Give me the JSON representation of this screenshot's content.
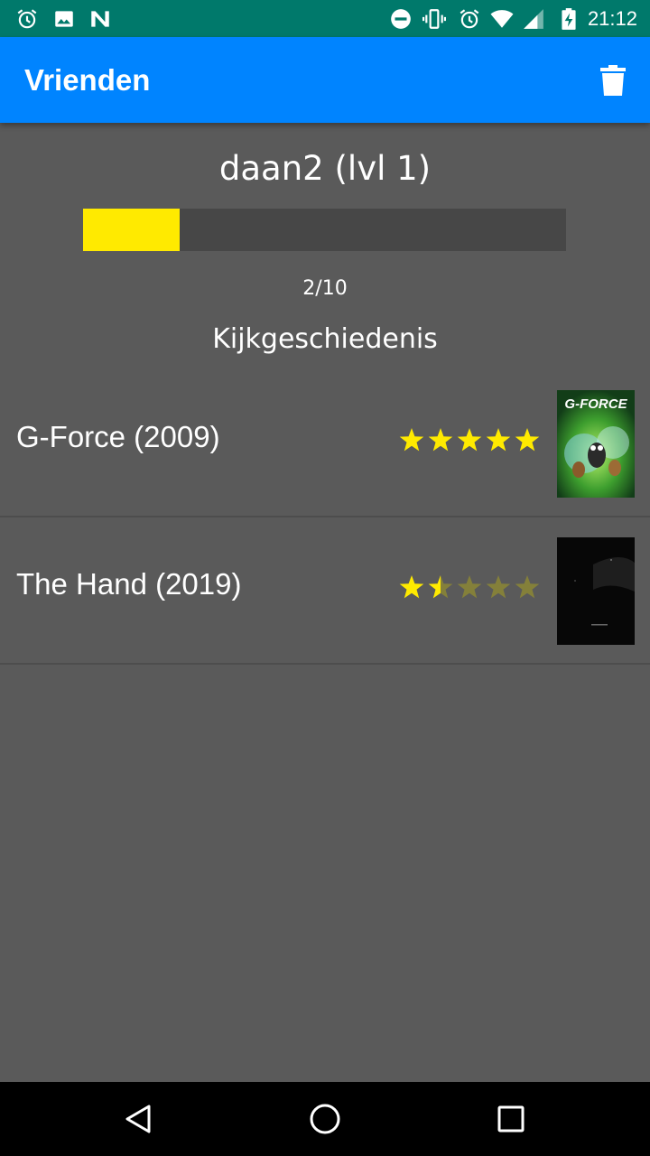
{
  "status_bar": {
    "time": "21:12",
    "left_icons": [
      "alarm-icon",
      "image-icon",
      "n-notification-icon"
    ],
    "right_icons": [
      "do-not-disturb-icon",
      "vibrate-icon",
      "alarm-icon",
      "wifi-icon",
      "signal-icon",
      "battery-charging-icon"
    ]
  },
  "app_bar": {
    "title": "Vrienden",
    "action_icon": "trash-icon"
  },
  "profile": {
    "name": "daan2 (lvl 1)",
    "xp_current": 2,
    "xp_max": 10,
    "xp_text": "2/10",
    "xp_color": "#ffea00"
  },
  "history": {
    "title": "Kijkgeschiedenis",
    "items": [
      {
        "title": "G-Force (2009)",
        "rating": 5,
        "max_rating": 5,
        "poster_text": "G-FORCE"
      },
      {
        "title": "The Hand (2019)",
        "rating": 1.5,
        "max_rating": 5
      }
    ]
  },
  "nav_bar": {
    "buttons": [
      "back-icon",
      "home-icon",
      "recents-icon"
    ]
  },
  "colors": {
    "app_bar": "#0084ff",
    "status_bar": "#00796b",
    "background": "#5a5a5a",
    "star_filled": "#ffea00",
    "star_empty": "#84803a"
  }
}
